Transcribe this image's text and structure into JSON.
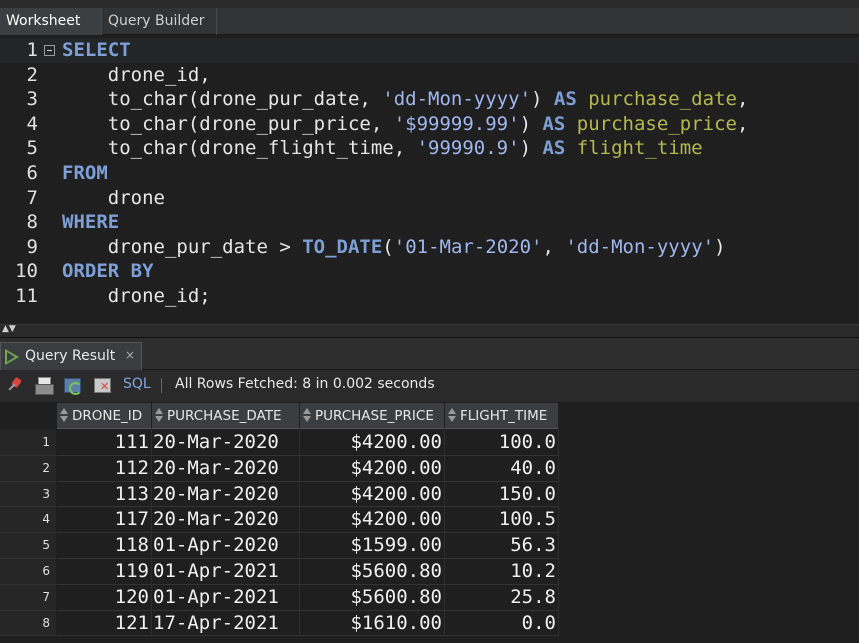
{
  "tabs": {
    "worksheet": "Worksheet",
    "query_builder": "Query Builder"
  },
  "editor": {
    "line_numbers": [
      "1",
      "2",
      "3",
      "4",
      "5",
      "6",
      "7",
      "8",
      "9",
      "10",
      "11"
    ],
    "lines": [
      [
        {
          "t": "SELECT",
          "c": "kw"
        }
      ],
      [
        {
          "t": "    drone_id,",
          "c": "plain"
        }
      ],
      [
        {
          "t": "    to_char(drone_pur_date, ",
          "c": "plain"
        },
        {
          "t": "'dd-Mon-yyyy'",
          "c": "str"
        },
        {
          "t": ") ",
          "c": "plain"
        },
        {
          "t": "AS",
          "c": "kw"
        },
        {
          "t": " purchase_date",
          "c": "alias"
        },
        {
          "t": ",",
          "c": "plain"
        }
      ],
      [
        {
          "t": "    to_char(drone_pur_price, ",
          "c": "plain"
        },
        {
          "t": "'$99999.99'",
          "c": "str"
        },
        {
          "t": ") ",
          "c": "plain"
        },
        {
          "t": "AS",
          "c": "kw"
        },
        {
          "t": " purchase_price",
          "c": "alias"
        },
        {
          "t": ",",
          "c": "plain"
        }
      ],
      [
        {
          "t": "    to_char(drone_flight_time, ",
          "c": "plain"
        },
        {
          "t": "'99990.9'",
          "c": "str"
        },
        {
          "t": ") ",
          "c": "plain"
        },
        {
          "t": "AS",
          "c": "kw"
        },
        {
          "t": " flight_time",
          "c": "alias"
        }
      ],
      [
        {
          "t": "FROM",
          "c": "kw"
        }
      ],
      [
        {
          "t": "    drone",
          "c": "plain"
        }
      ],
      [
        {
          "t": "WHERE",
          "c": "kw"
        }
      ],
      [
        {
          "t": "    drone_pur_date > ",
          "c": "plain"
        },
        {
          "t": "TO_DATE",
          "c": "kw"
        },
        {
          "t": "(",
          "c": "plain"
        },
        {
          "t": "'01-Mar-2020'",
          "c": "str"
        },
        {
          "t": ", ",
          "c": "plain"
        },
        {
          "t": "'dd-Mon-yyyy'",
          "c": "str"
        },
        {
          "t": ")",
          "c": "plain"
        }
      ],
      [
        {
          "t": "ORDER BY",
          "c": "kw"
        }
      ],
      [
        {
          "t": "    drone_id;",
          "c": "plain"
        }
      ]
    ]
  },
  "result_tab": {
    "label": "Query Result",
    "close": "×"
  },
  "toolbar": {
    "sql_label": "SQL",
    "status": "All Rows Fetched: 8 in 0.002 seconds"
  },
  "grid": {
    "columns": [
      "DRONE_ID",
      "PURCHASE_DATE",
      "PURCHASE_PRICE",
      "FLIGHT_TIME"
    ],
    "rows": [
      {
        "n": "1",
        "id": "111",
        "date": "20-Mar-2020",
        "price": "$4200.00",
        "time": "100.0"
      },
      {
        "n": "2",
        "id": "112",
        "date": "20-Mar-2020",
        "price": "$4200.00",
        "time": "40.0"
      },
      {
        "n": "3",
        "id": "113",
        "date": "20-Mar-2020",
        "price": "$4200.00",
        "time": "150.0"
      },
      {
        "n": "4",
        "id": "117",
        "date": "20-Mar-2020",
        "price": "$4200.00",
        "time": "100.5"
      },
      {
        "n": "5",
        "id": "118",
        "date": "01-Apr-2020",
        "price": "$1599.00",
        "time": "56.3"
      },
      {
        "n": "6",
        "id": "119",
        "date": "01-Apr-2021",
        "price": "$5600.80",
        "time": "10.2"
      },
      {
        "n": "7",
        "id": "120",
        "date": "01-Apr-2021",
        "price": "$5600.80",
        "time": "25.8"
      },
      {
        "n": "8",
        "id": "121",
        "date": "17-Apr-2021",
        "price": "$1610.00",
        "time": "0.0"
      }
    ]
  }
}
